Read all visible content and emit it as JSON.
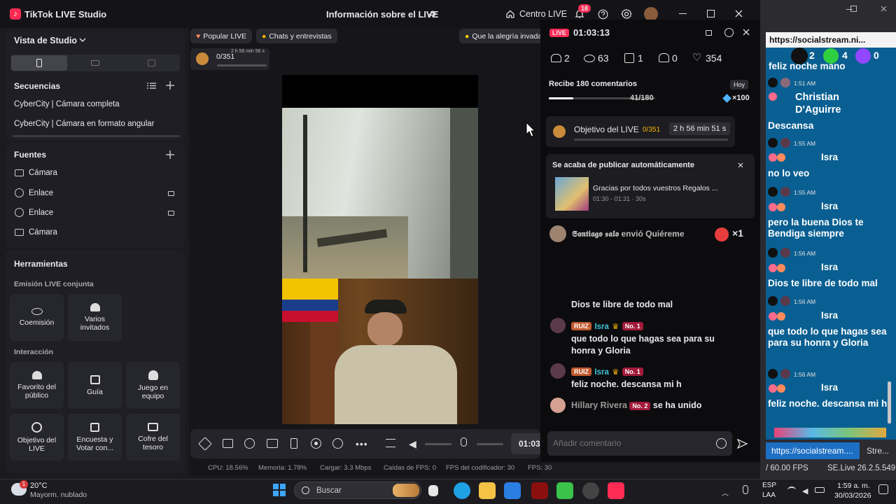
{
  "window": {
    "app_title": "TikTok LIVE Studio",
    "center_title": "Información sobre el LIVE",
    "centro_label": "Centro LIVE",
    "notif_count": "18"
  },
  "studio": {
    "view_label": "Vista de Studio"
  },
  "sequences": {
    "title": "Secuencias",
    "items": [
      "CyberCity | Cámara completa",
      "CyberCity | Cámara en formato angular"
    ]
  },
  "sources": {
    "title": "Fuentes",
    "items": [
      "Cámara",
      "Enlace",
      "Enlace",
      "Cámara"
    ]
  },
  "tools": {
    "title": "Herramientas",
    "group1": "Emisión LIVE conjunta",
    "coemision": "Coemisión",
    "varios": "Varios invitados",
    "group2": "Interacción",
    "favorito": "Favorito del público",
    "guia": "Guía",
    "juego": "Juego en equipo",
    "objetivo": "Objetivo del LIVE",
    "encuesta": "Encuesta y Votar con...",
    "cofre": "Cofre del tesoro"
  },
  "top_pills": {
    "popular": "Popular LIVE",
    "chats": "Chats y entrevistas",
    "alegria": "Que la alegría invada"
  },
  "goal_mini": {
    "progress": "0/351",
    "time": "2 h 56 min 56 s",
    "fill": 0.0
  },
  "stats": {
    "cpu": "CPU:  18.56%",
    "mem": "Memoria:  1.78%",
    "upload": "Cargar:  3.3 Mbps",
    "drops": "Caídas de FPS:  0",
    "encoder": "FPS del codificador:  30",
    "fps": "FPS:  30"
  },
  "controls": {
    "timer": "01:03"
  },
  "live": {
    "badge": "LIVE",
    "elapsed": "01:03:13",
    "stats": {
      "viewers_now": "2",
      "views": "63",
      "gifts": "1",
      "new_followers": "0",
      "likes": "354"
    },
    "comments_goal": {
      "label": "Recibe 180 comentarios",
      "progress": "41/180",
      "fill": 0.228,
      "today": "Hoy",
      "reward": "×100"
    },
    "objetivo": {
      "label": "Objetivo del LIVE",
      "progress": "0/351",
      "time": "2 h 56 min 51 s",
      "fill": 0.0
    },
    "autopost": {
      "title": "Se acaba de publicar automáticamente",
      "caption": "Gracias por todos vuestros Regalos ...",
      "range": "01:30 - 01:31 · 30s"
    },
    "gift": {
      "user": "𝕾𝖆𝖓𝖙𝖎𝖆𝖌𝖔 𝖘𝖆𝖑𝖔",
      "verb": "envió Quiéreme",
      "count": "×1"
    },
    "chat": [
      {
        "text": "Dios te libre de todo mal"
      },
      {
        "club": "RUIZ",
        "user": "Isra",
        "rank": "No. 1",
        "text": "que todo lo que hagas sea para su honra y Gloria"
      },
      {
        "club": "RUIZ",
        "user": "Isra",
        "rank": "No. 1",
        "text": "feliz noche. descansa mi h"
      }
    ],
    "joined": {
      "user": "Hillary Rivera",
      "rank": "No. 2",
      "text": "se ha unido"
    },
    "input_placeholder": "Añadir comentario"
  },
  "socialstream": {
    "url": "https://socialstream.ni...",
    "counts": [
      "2",
      "4",
      "0"
    ],
    "cut_top": "feliz noche mano",
    "messages": [
      {
        "time": "1:51 AM",
        "user": "Christian D'Aguirre",
        "text": "Descansa"
      },
      {
        "time": "1:55 AM",
        "user": "Isra",
        "text": "no lo veo"
      },
      {
        "time": "1:55 AM",
        "user": "Isra",
        "text": "pero la buena Dios te Bendiga siempre"
      },
      {
        "time": "1:56 AM",
        "user": "Isra",
        "text": "Dios te libre de todo mal"
      },
      {
        "time": "1:56 AM",
        "user": "Isra",
        "text": "que todo lo que hagas sea para su honra y Gloria"
      },
      {
        "time": "1:56 AM",
        "user": "Isra",
        "text": "feliz noche. descansa mi h"
      }
    ],
    "bottom_url": "https://socialstream....",
    "bottom_tab": "Stre...",
    "fps": "/ 60.00 FPS",
    "version": "SE.Live 26.2.5.549"
  },
  "taskbar": {
    "weather_temp": "20°C",
    "weather_desc": "Mayorm. nublado",
    "weather_badge": "1",
    "search": "Buscar",
    "lang1": "ESP",
    "lang2": "LAA",
    "time": "1:59 a. m.",
    "date": "30/03/2026"
  },
  "colors": {
    "accent": "#fe2c55",
    "tiktok_cyan": "#25f4ee",
    "gold": "#f5b400"
  }
}
